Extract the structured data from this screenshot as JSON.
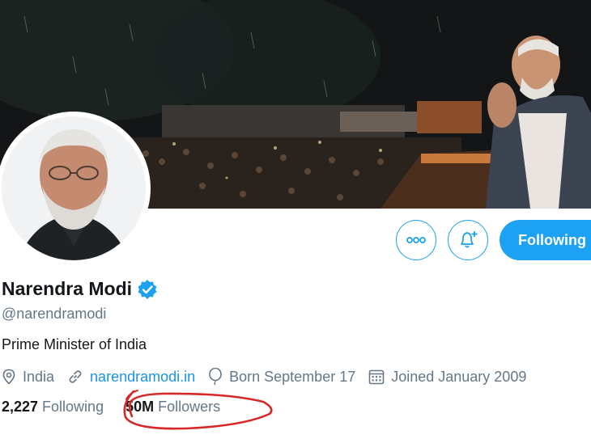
{
  "profile": {
    "name": "Narendra Modi",
    "handle": "@narendramodi",
    "bio": "Prime Minister of India",
    "verified": true
  },
  "meta": {
    "location": "India",
    "website": "narendramodi.in",
    "birthday": "Born September 17",
    "joined": "Joined January 2009"
  },
  "stats": {
    "following_count": "2,227",
    "following_label": "Following",
    "followers_count": "50M",
    "followers_label": "Followers"
  },
  "actions": {
    "follow_state_label": "Following"
  },
  "icons": [
    "more-icon",
    "notification-bell-icon",
    "verified-badge-icon",
    "location-icon",
    "link-icon",
    "balloon-icon",
    "calendar-icon"
  ],
  "colors": {
    "accent": "#1da1f2",
    "link": "#1b95e0",
    "secondary_text": "#657786",
    "annotation": "#d62828"
  }
}
